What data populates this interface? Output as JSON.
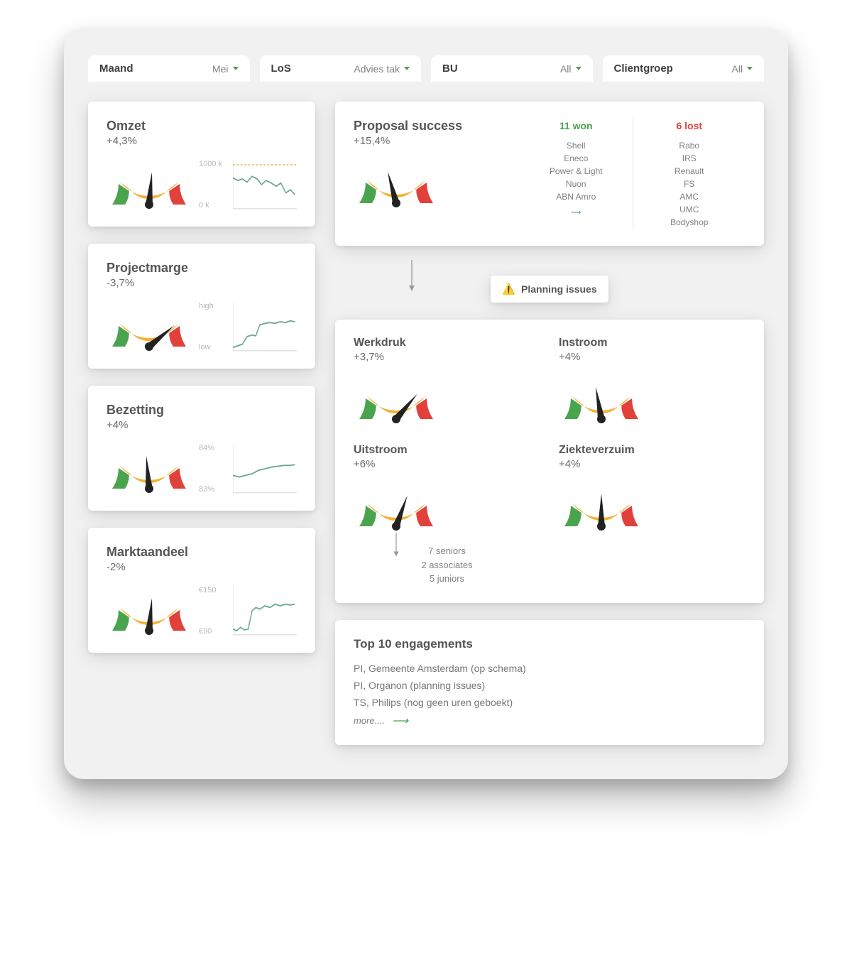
{
  "filters": [
    {
      "label": "Maand",
      "value": "Mei"
    },
    {
      "label": "LoS",
      "value": "Advies tak"
    },
    {
      "label": "BU",
      "value": "All"
    },
    {
      "label": "Clientgroep",
      "value": "All"
    }
  ],
  "left_metrics": [
    {
      "title": "Omzet",
      "delta": "+4,3%",
      "needle_angle": 95,
      "ticks": [
        "1000 k",
        "0 k"
      ],
      "spark_type": "revenue"
    },
    {
      "title": "Projectmarge",
      "delta": "-3,7%",
      "needle_angle": 140,
      "ticks": [
        "high",
        "low"
      ],
      "spark_type": "margin"
    },
    {
      "title": "Bezetting",
      "delta": "+4%",
      "needle_angle": 85,
      "ticks": [
        "84%",
        "83%"
      ],
      "spark_type": "occupancy"
    },
    {
      "title": "Marktaandeel",
      "delta": "-2%",
      "needle_angle": 95,
      "ticks": [
        "€150",
        "€90"
      ],
      "spark_type": "market"
    }
  ],
  "proposal": {
    "title": "Proposal success",
    "delta": "+15,4%",
    "needle_angle": 75,
    "won_head": "11 won",
    "lost_head": "6 lost",
    "won": [
      "Shell",
      "Eneco",
      "Power & Light",
      "Nuon",
      "ABN Amro"
    ],
    "lost": [
      "Rabo",
      "IRS",
      "Renault",
      "FS",
      "AMC",
      "UMC",
      "Bodyshop"
    ]
  },
  "planning_flag": "Planning issues",
  "planning_metrics": [
    {
      "title": "Werkdruk",
      "delta": "+3,7%",
      "needle_angle": 130
    },
    {
      "title": "Instroom",
      "delta": "+4%",
      "needle_angle": 80
    },
    {
      "title": "Uitstroom",
      "delta": "+6%",
      "needle_angle": 110,
      "breakdown": [
        "7 seniors",
        "2 associates",
        "5 juniors"
      ]
    },
    {
      "title": "Ziekteverzuim",
      "delta": "+4%",
      "needle_angle": 90
    }
  ],
  "engagements": {
    "title": "Top 10 engagements",
    "items": [
      "PI, Gemeente Amsterdam (op schema)",
      "PI, Organon (planning issues)",
      "TS, Philips (nog geen uren geboekt)"
    ],
    "more": "more...."
  },
  "chart_data": [
    {
      "type": "gauge",
      "title": "Omzet",
      "value": 95,
      "domain": [
        180,
        0
      ],
      "segments": [
        {
          "name": "red",
          "range": [
            180,
            144
          ]
        },
        {
          "name": "orange",
          "range": [
            144,
            36
          ]
        },
        {
          "name": "green",
          "range": [
            36,
            0
          ]
        }
      ],
      "delta_pct": 4.3,
      "note": "needle angle in degrees, 180=left 0=right"
    },
    {
      "type": "line",
      "title": "Omzet sparkline",
      "x_range": [
        0,
        100
      ],
      "ylim": [
        0,
        1000
      ],
      "y_unit": "k",
      "target": 1000,
      "values": [
        710,
        680,
        700,
        650,
        730,
        700,
        620,
        690,
        650,
        600,
        640,
        520,
        560,
        500
      ],
      "ticks_y": [
        0,
        1000
      ]
    },
    {
      "type": "gauge",
      "title": "Projectmarge",
      "value": 140,
      "domain": [
        180,
        0
      ],
      "delta_pct": -3.7
    },
    {
      "type": "line",
      "title": "Projectmarge sparkline",
      "ticks_y": [
        "low",
        "high"
      ],
      "values": [
        0.1,
        0.12,
        0.15,
        0.3,
        0.35,
        0.33,
        0.55,
        0.58,
        0.6,
        0.58,
        0.62,
        0.6,
        0.63,
        0.62
      ]
    },
    {
      "type": "gauge",
      "title": "Bezetting",
      "value": 85,
      "domain": [
        180,
        0
      ],
      "delta_pct": 4.0
    },
    {
      "type": "line",
      "title": "Bezetting sparkline",
      "ylim": [
        83,
        84
      ],
      "y_unit": "%",
      "values": [
        83.45,
        83.4,
        83.42,
        83.45,
        83.48,
        83.55,
        83.6,
        83.62,
        83.64,
        83.66,
        83.67,
        83.68
      ],
      "ticks_y": [
        83,
        84
      ]
    },
    {
      "type": "gauge",
      "title": "Marktaandeel",
      "value": 95,
      "domain": [
        180,
        0
      ],
      "delta_pct": -2.0
    },
    {
      "type": "line",
      "title": "Marktaandeel sparkline",
      "ylim": [
        90,
        150
      ],
      "y_unit": "€",
      "values": [
        95,
        93,
        96,
        92,
        94,
        118,
        124,
        122,
        128,
        126,
        130,
        128,
        131,
        129
      ],
      "ticks_y": [
        90,
        150
      ]
    },
    {
      "type": "gauge",
      "title": "Proposal success",
      "value": 75,
      "domain": [
        180,
        0
      ],
      "delta_pct": 15.4
    },
    {
      "type": "table",
      "title": "Proposal outcomes",
      "columns": [
        "won",
        "lost"
      ],
      "rows": [
        [
          "Shell",
          "Rabo"
        ],
        [
          "Eneco",
          "IRS"
        ],
        [
          "Power & Light",
          "Renault"
        ],
        [
          "Nuon",
          "FS"
        ],
        [
          "ABN Amro",
          "AMC"
        ],
        [
          "",
          "UMC"
        ],
        [
          "",
          "Bodyshop"
        ]
      ],
      "won_count": 11,
      "lost_count": 6
    },
    {
      "type": "gauge",
      "title": "Werkdruk",
      "value": 130,
      "domain": [
        180,
        0
      ],
      "delta_pct": 3.7
    },
    {
      "type": "gauge",
      "title": "Instroom",
      "value": 80,
      "domain": [
        180,
        0
      ],
      "delta_pct": 4.0
    },
    {
      "type": "gauge",
      "title": "Uitstroom",
      "value": 110,
      "domain": [
        180,
        0
      ],
      "delta_pct": 6.0,
      "breakdown": {
        "seniors": 7,
        "associates": 2,
        "juniors": 5
      }
    },
    {
      "type": "gauge",
      "title": "Ziekteverzuim",
      "value": 90,
      "domain": [
        180,
        0
      ],
      "delta_pct": 4.0
    }
  ]
}
